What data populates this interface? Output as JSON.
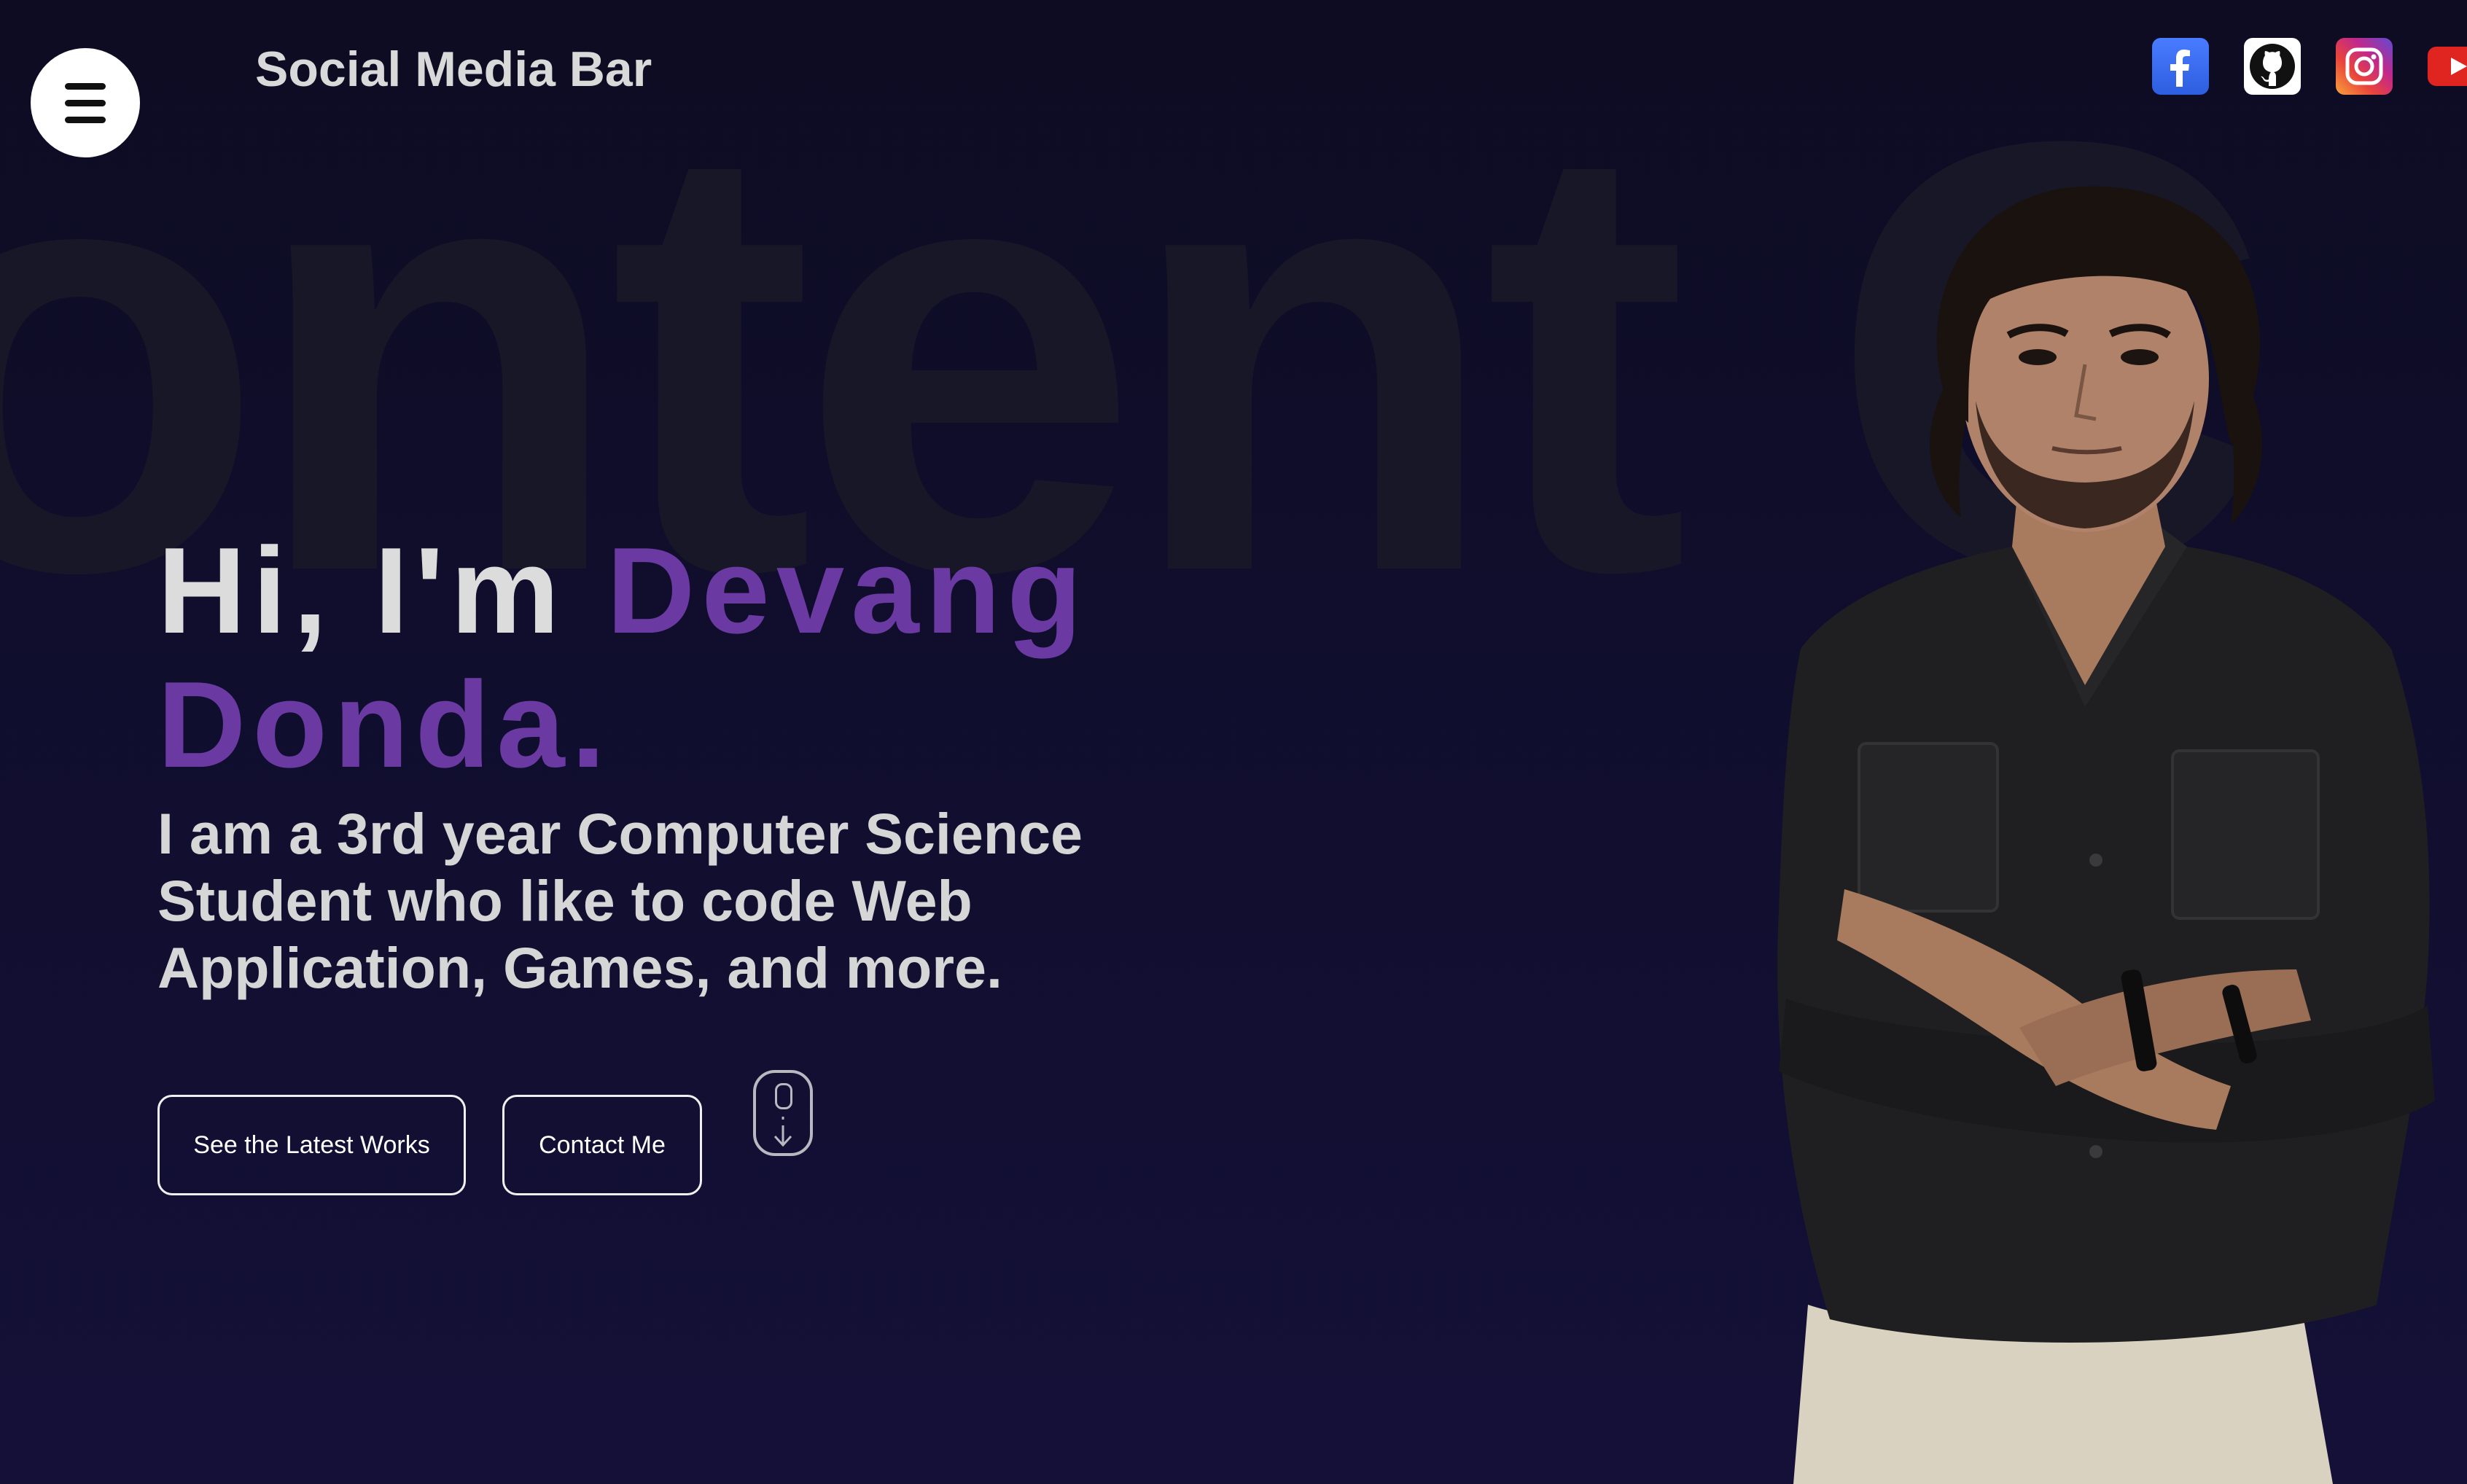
{
  "background": {
    "word": "ontent C"
  },
  "header": {
    "brand": "Social Media Bar",
    "menu_icon": "hamburger-menu-icon",
    "socials": [
      {
        "name": "facebook",
        "icon": "facebook-icon",
        "color": "#3b5bcc"
      },
      {
        "name": "github",
        "icon": "github-icon",
        "color": "#ffffff"
      },
      {
        "name": "instagram",
        "icon": "instagram-icon",
        "color": "#c2288b"
      },
      {
        "name": "youtube",
        "icon": "youtube-icon",
        "color": "#e0241f"
      }
    ]
  },
  "hero": {
    "greeting": "Hi, I'm ",
    "name": "Devang Donda.",
    "subtitle": "I am a 3rd year Computer Science Student who like to code Web Application, Games, and more.",
    "accent_color": "#6a3aa2"
  },
  "actions": {
    "works_label": "See the Latest Works",
    "contact_label": "Contact Me",
    "scroll_icon": "mouse-scroll-down-icon"
  },
  "portrait": {
    "icon": "profile-photo"
  }
}
